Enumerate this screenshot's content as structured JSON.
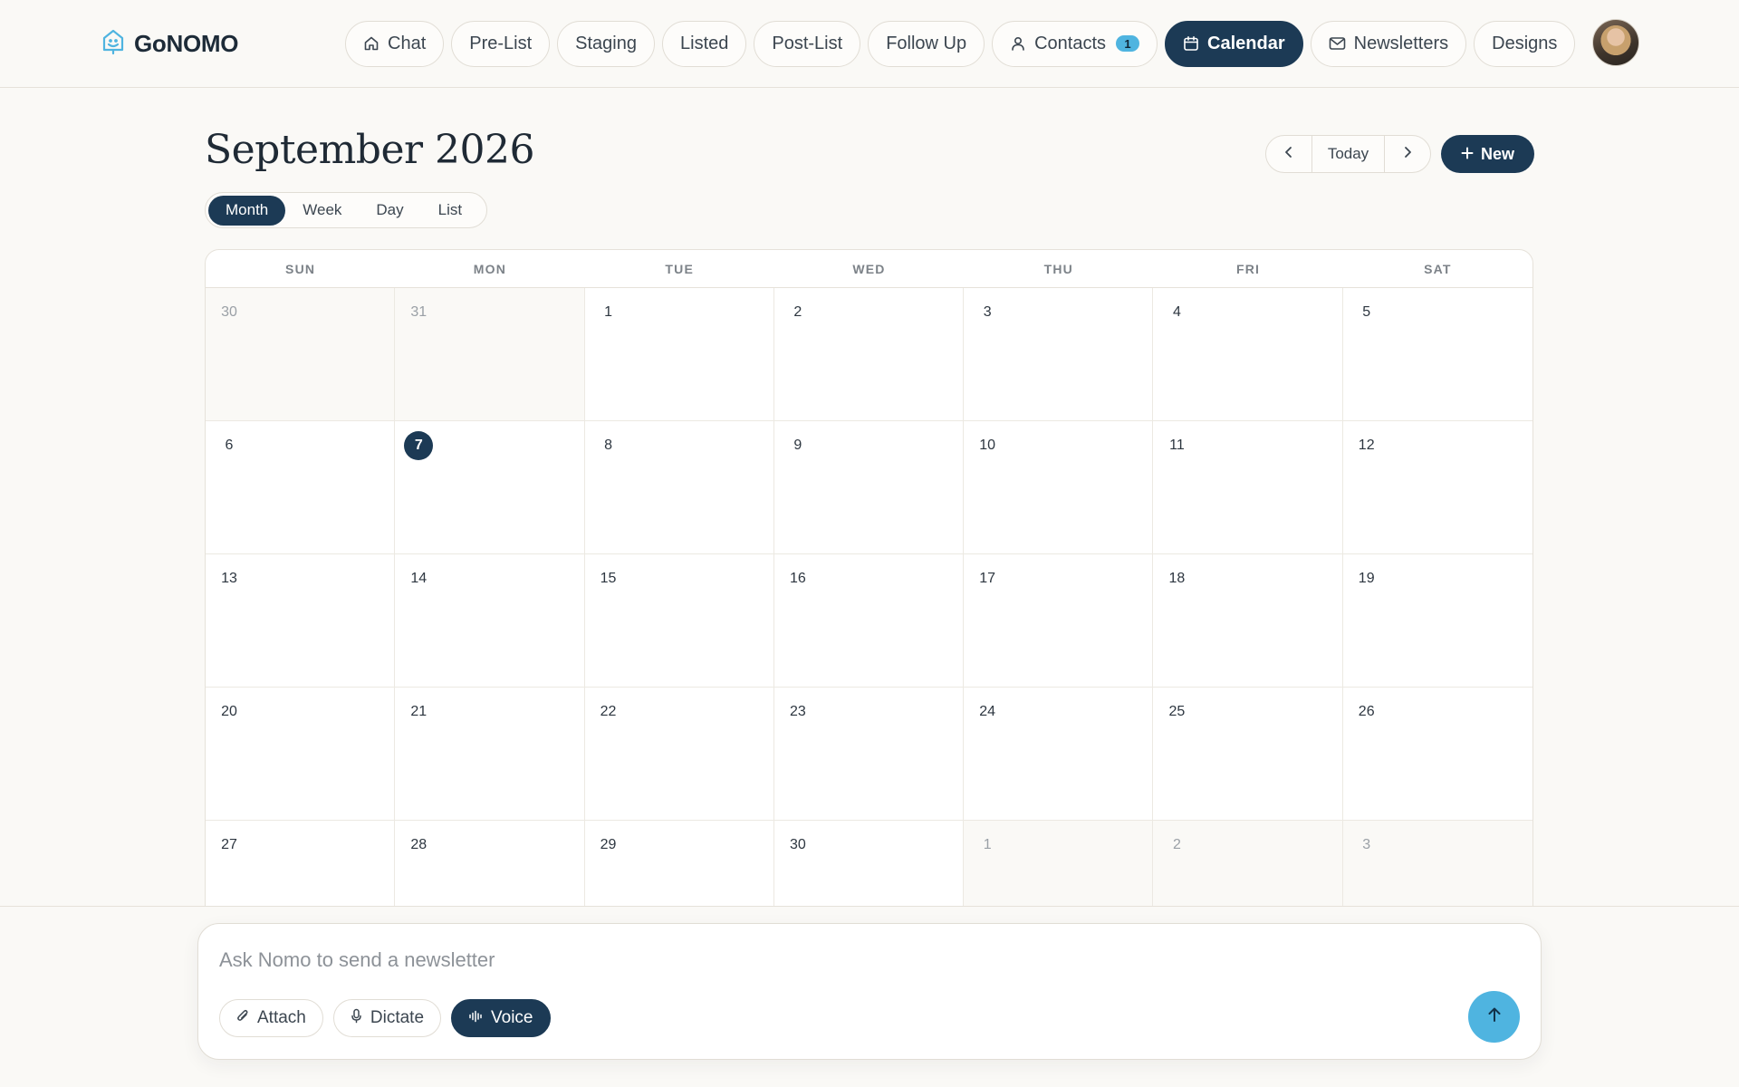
{
  "brand": {
    "name": "GoNOMO"
  },
  "nav": {
    "items": [
      {
        "label": "Chat",
        "icon": "home-icon"
      },
      {
        "label": "Pre-List"
      },
      {
        "label": "Staging"
      },
      {
        "label": "Listed"
      },
      {
        "label": "Post-List"
      },
      {
        "label": "Follow Up"
      },
      {
        "label": "Contacts",
        "icon": "person-icon",
        "badge": "1"
      },
      {
        "label": "Calendar",
        "icon": "calendar-icon",
        "active": true
      },
      {
        "label": "Newsletters",
        "icon": "mail-icon"
      },
      {
        "label": "Designs"
      }
    ]
  },
  "calendar": {
    "title": "September 2026",
    "views": [
      "Month",
      "Week",
      "Day",
      "List"
    ],
    "active_view": "Month",
    "today_label": "Today",
    "new_label": "New",
    "weekdays": [
      "SUN",
      "MON",
      "TUE",
      "WED",
      "THU",
      "FRI",
      "SAT"
    ],
    "days": [
      {
        "n": "30",
        "other": true
      },
      {
        "n": "31",
        "other": true
      },
      {
        "n": "1"
      },
      {
        "n": "2"
      },
      {
        "n": "3"
      },
      {
        "n": "4"
      },
      {
        "n": "5"
      },
      {
        "n": "6"
      },
      {
        "n": "7",
        "today": true
      },
      {
        "n": "8"
      },
      {
        "n": "9"
      },
      {
        "n": "10"
      },
      {
        "n": "11"
      },
      {
        "n": "12"
      },
      {
        "n": "13"
      },
      {
        "n": "14"
      },
      {
        "n": "15"
      },
      {
        "n": "16"
      },
      {
        "n": "17"
      },
      {
        "n": "18"
      },
      {
        "n": "19"
      },
      {
        "n": "20"
      },
      {
        "n": "21"
      },
      {
        "n": "22"
      },
      {
        "n": "23"
      },
      {
        "n": "24"
      },
      {
        "n": "25"
      },
      {
        "n": "26"
      },
      {
        "n": "27"
      },
      {
        "n": "28"
      },
      {
        "n": "29"
      },
      {
        "n": "30"
      },
      {
        "n": "1",
        "other": true
      },
      {
        "n": "2",
        "other": true
      },
      {
        "n": "3",
        "other": true
      }
    ]
  },
  "composer": {
    "placeholder": "Ask Nomo to send a newsletter",
    "attach_label": "Attach",
    "dictate_label": "Dictate",
    "voice_label": "Voice"
  },
  "colors": {
    "accent": "#1c3a55",
    "highlight": "#4fb4e0",
    "background": "#faf9f6"
  }
}
